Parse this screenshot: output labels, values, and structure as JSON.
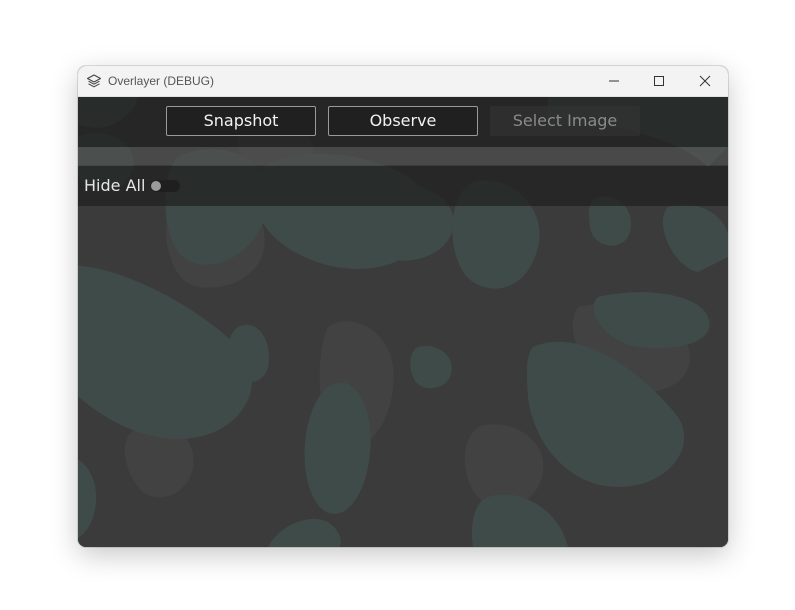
{
  "window": {
    "title": "Overlayer (DEBUG)",
    "app_icon": "layers-icon",
    "controls": [
      "minimize-icon",
      "maximize-icon",
      "close-icon"
    ]
  },
  "toolbar": {
    "snapshot_label": "Snapshot",
    "observe_label": "Observe",
    "select_image_label": "Select Image"
  },
  "hide_all": {
    "label": "Hide All",
    "enabled": false
  },
  "colors": {
    "background": "#3b3b3b",
    "camo_shape": "#3f4b48",
    "titlebar": "#f3f3f3",
    "button_bg": "#202020",
    "button_border": "#9a9a9a",
    "disabled_text": "#8a8a8a"
  }
}
